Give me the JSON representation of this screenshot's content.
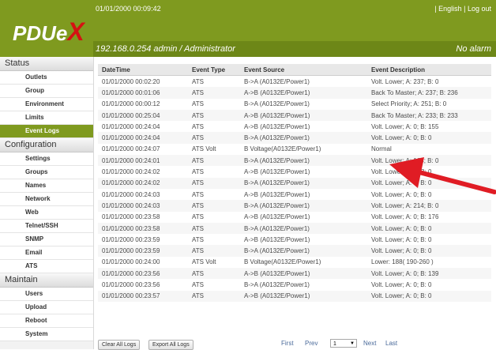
{
  "header": {
    "logo_main": "PDUe",
    "logo_accent": "X",
    "datetime": "01/01/2000 00:09:42",
    "language": "English",
    "separator": "|",
    "logout": "Log out",
    "ip_user": "192.168.0.254  admin / Administrator",
    "alarm": "No alarm"
  },
  "sidebar": {
    "status_label": "Status",
    "status_items": [
      "Outlets",
      "Group",
      "Environment",
      "Limits",
      "Event Logs"
    ],
    "config_label": "Configuration",
    "config_items": [
      "Settings",
      "Groups",
      "Names",
      "Network",
      "Web",
      "Telnet/SSH",
      "SNMP",
      "Email",
      "ATS"
    ],
    "maintain_label": "Maintain",
    "maintain_items": [
      "Users",
      "Upload",
      "Reboot",
      "System"
    ]
  },
  "table": {
    "headers": [
      "DateTime",
      "Event Type",
      "Event Source",
      "Event Description"
    ],
    "rows": [
      [
        "01/01/2000 00:02:20",
        "ATS",
        "B->A (A0132E/Power1)",
        "Volt. Lower; A: 237; B: 0"
      ],
      [
        "01/01/2000 00:01:06",
        "ATS",
        "A->B (A0132E/Power1)",
        "Back To Master; A: 237; B: 236"
      ],
      [
        "01/01/2000 00:00:12",
        "ATS",
        "B->A (A0132E/Power1)",
        "Select Priority; A: 251; B: 0"
      ],
      [
        "01/01/2000 00:25:04",
        "ATS",
        "A->B (A0132E/Power1)",
        "Back To Master; A: 233; B: 233"
      ],
      [
        "01/01/2000 00:24:04",
        "ATS",
        "A->B (A0132E/Power1)",
        "Volt. Lower; A: 0; B: 155"
      ],
      [
        "01/01/2000 00:24:04",
        "ATS",
        "B->A (A0132E/Power1)",
        "Volt. Lower; A: 0; B: 0"
      ],
      [
        "01/01/2000 00:24:07",
        "ATS Volt",
        "B Voltage(A0132E/Power1)",
        "Normal"
      ],
      [
        "01/01/2000 00:24:01",
        "ATS",
        "B->A (A0132E/Power1)",
        "Volt. Lower; A: 164; B: 0"
      ],
      [
        "01/01/2000 00:24:02",
        "ATS",
        "A->B (A0132E/Power1)",
        "Volt. Lower; A: 0; B: 0"
      ],
      [
        "01/01/2000 00:24:02",
        "ATS",
        "B->A (A0132E/Power1)",
        "Volt. Lower; A: 0; B: 0"
      ],
      [
        "01/01/2000 00:24:03",
        "ATS",
        "A->B (A0132E/Power1)",
        "Volt. Lower; A: 0; B: 0"
      ],
      [
        "01/01/2000 00:24:03",
        "ATS",
        "B->A (A0132E/Power1)",
        "Volt. Lower; A: 214; B: 0"
      ],
      [
        "01/01/2000 00:23:58",
        "ATS",
        "A->B (A0132E/Power1)",
        "Volt. Lower; A: 0; B: 176"
      ],
      [
        "01/01/2000 00:23:58",
        "ATS",
        "B->A (A0132E/Power1)",
        "Volt. Lower; A: 0; B: 0"
      ],
      [
        "01/01/2000 00:23:59",
        "ATS",
        "A->B (A0132E/Power1)",
        "Volt. Lower; A: 0; B: 0"
      ],
      [
        "01/01/2000 00:23:59",
        "ATS",
        "B->A (A0132E/Power1)",
        "Volt. Lower; A: 0; B: 0"
      ],
      [
        "01/01/2000 00:24:00",
        "ATS Volt",
        "B Voltage(A0132E/Power1)",
        "Lower: 188( 190-260 )"
      ],
      [
        "01/01/2000 00:23:56",
        "ATS",
        "A->B (A0132E/Power1)",
        "Volt. Lower; A: 0; B: 139"
      ],
      [
        "01/01/2000 00:23:56",
        "ATS",
        "B->A (A0132E/Power1)",
        "Volt. Lower; A: 0; B: 0"
      ],
      [
        "01/01/2000 00:23:57",
        "ATS",
        "A->B (A0132E/Power1)",
        "Volt. Lower; A: 0; B: 0"
      ]
    ]
  },
  "footer": {
    "clear_all": "Clear All Logs",
    "export_all": "Export All Logs",
    "first": "First",
    "prev": "Prev",
    "page": "1",
    "next": "Next",
    "last": "Last"
  },
  "colors": {
    "brand_green": "#7f9a1f",
    "logo_accent": "#d51212",
    "annotation_arrow": "#e01c24"
  },
  "icons": {
    "annotation": "red-arrow-icon",
    "dropdown": "chevron-down-icon"
  }
}
